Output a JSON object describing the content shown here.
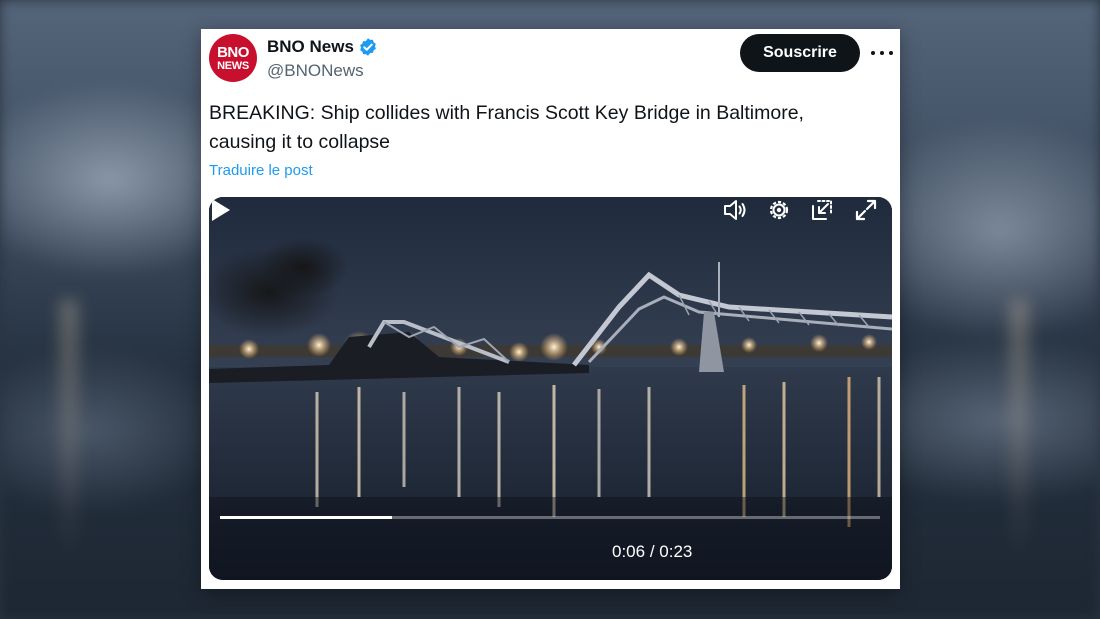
{
  "account": {
    "avatar_line1": "BNO",
    "avatar_line2": "NEWS",
    "name": "BNO News",
    "handle": "@BNONews",
    "verified_icon": "verified-badge-icon"
  },
  "actions": {
    "subscribe_label": "Souscrire",
    "more_icon": "more-dots-icon"
  },
  "post": {
    "text": "BREAKING: Ship collides with Francis Scott Key Bridge in Baltimore, causing it to collapse",
    "translate_label": "Traduire le post"
  },
  "video": {
    "current_time": "0:06",
    "duration": "0:23",
    "time_separator": "/",
    "progress": 0.26,
    "controls": [
      "play-icon",
      "volume-icon",
      "settings-icon",
      "picture-in-picture-icon",
      "fullscreen-icon"
    ]
  },
  "colors": {
    "accent": "#1d9bf0",
    "brand_red": "#c8102e",
    "button_dark": "#0f1419",
    "handle_gray": "#536471"
  }
}
